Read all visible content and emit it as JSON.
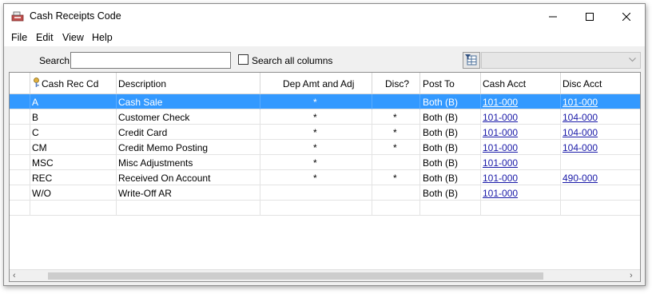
{
  "window": {
    "title": "Cash Receipts Code",
    "menu": [
      "File",
      "Edit",
      "View",
      "Help"
    ]
  },
  "toolbar": {
    "search_label": "Search:",
    "search_value": "",
    "search_all_label": "Search all columns",
    "search_all_checked": false
  },
  "grid": {
    "columns": [
      "Cash Rec Cd",
      "Description",
      "Dep Amt and Adj",
      "Disc?",
      "Post To",
      "Cash Acct",
      "Disc Acct"
    ],
    "rows": [
      {
        "code": "A",
        "description": "Cash Sale",
        "dep": "*",
        "disc": "",
        "post_to": "Both (B)",
        "cash_acct": "101-000",
        "disc_acct": "101-000",
        "selected": true
      },
      {
        "code": "B",
        "description": "Customer Check",
        "dep": "*",
        "disc": "*",
        "post_to": "Both (B)",
        "cash_acct": "101-000",
        "disc_acct": "104-000",
        "selected": false
      },
      {
        "code": "C",
        "description": "Credit Card",
        "dep": "*",
        "disc": "*",
        "post_to": "Both (B)",
        "cash_acct": "101-000",
        "disc_acct": "104-000",
        "selected": false
      },
      {
        "code": "CM",
        "description": "Credit Memo Posting",
        "dep": "*",
        "disc": "*",
        "post_to": "Both (B)",
        "cash_acct": "101-000",
        "disc_acct": "104-000",
        "selected": false
      },
      {
        "code": "MSC",
        "description": "Misc Adjustments",
        "dep": "*",
        "disc": "",
        "post_to": "Both (B)",
        "cash_acct": "101-000",
        "disc_acct": "",
        "selected": false
      },
      {
        "code": "REC",
        "description": "Received On Account",
        "dep": "*",
        "disc": "*",
        "post_to": "Both (B)",
        "cash_acct": "101-000",
        "disc_acct": "490-000",
        "selected": false
      },
      {
        "code": "W/O",
        "description": "Write-Off AR",
        "dep": "",
        "disc": "",
        "post_to": "Both (B)",
        "cash_acct": "101-000",
        "disc_acct": "",
        "selected": false
      }
    ]
  },
  "colors": {
    "selection": "#3399ff",
    "link": "#1a1aa8"
  }
}
